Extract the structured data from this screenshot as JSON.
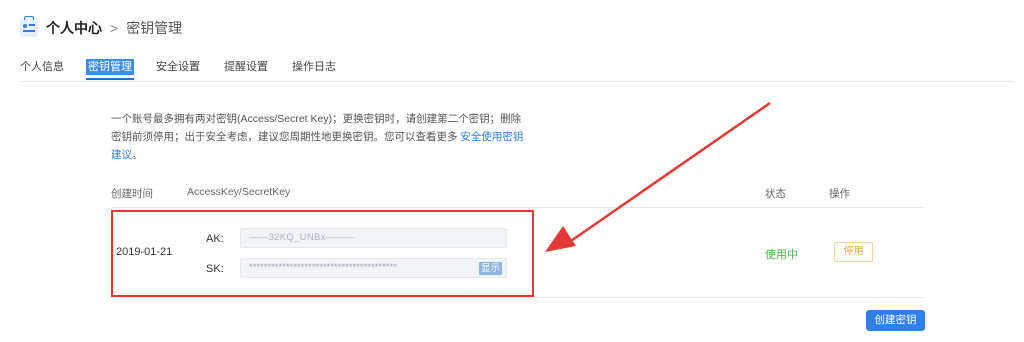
{
  "breadcrumb": {
    "root": "个人中心",
    "separator": ">",
    "current": "密钥管理"
  },
  "tabs": [
    {
      "label": "个人信息",
      "active": false
    },
    {
      "label": "密钥管理",
      "active": true
    },
    {
      "label": "安全设置",
      "active": false
    },
    {
      "label": "提醒设置",
      "active": false
    },
    {
      "label": "操作日志",
      "active": false
    }
  ],
  "notice": {
    "text": "一个账号最多拥有两对密钥(Access/Secret Key)；更换密钥时，请创建第二个密钥；删除密钥前须停用；出于安全考虑，建议您周期性地更换密钥。您可以查看更多 ",
    "link": "安全使用密钥建议",
    "suffix": "。"
  },
  "table": {
    "headers": {
      "created": "创建时间",
      "keys": "AccessKey/SecretKey",
      "status": "状态",
      "actions": "操作"
    },
    "rows": [
      {
        "created": "2019-01-21",
        "ak_label": "AK:",
        "ak_value": "——32KQ_UNBx———",
        "sk_label": "SK:",
        "sk_value": "****************************************",
        "show_label": "显示",
        "status": "使用中",
        "action": "停用"
      }
    ]
  },
  "create_button": "创建密钥",
  "colors": {
    "accent": "#2f80ed",
    "status_active": "#4caf50",
    "disable": "#f0a73a",
    "annotation": "#e53935"
  }
}
